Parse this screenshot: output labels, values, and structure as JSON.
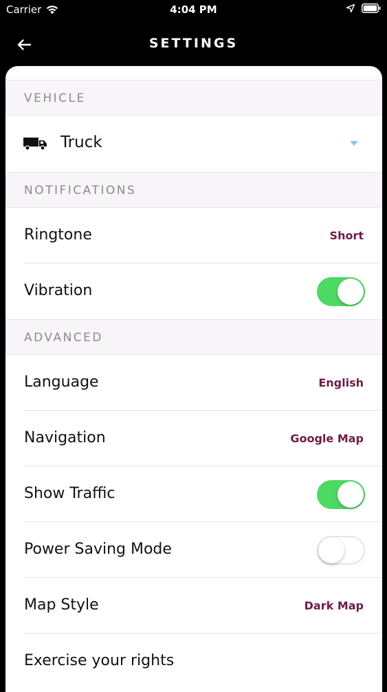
{
  "status_bar": {
    "carrier": "Carrier",
    "time": "4:04 PM"
  },
  "nav": {
    "title": "SETTINGS",
    "back_icon": "arrow-left-icon"
  },
  "sections": {
    "vehicle": {
      "header": "VEHICLE",
      "selected": "Truck",
      "icon": "truck-icon"
    },
    "notifications": {
      "header": "NOTIFICATIONS",
      "ringtone": {
        "label": "Ringtone",
        "value": "Short"
      },
      "vibration": {
        "label": "Vibration",
        "enabled": true
      }
    },
    "advanced": {
      "header": "ADVANCED",
      "language": {
        "label": "Language",
        "value": "English"
      },
      "navigation": {
        "label": "Navigation",
        "value": "Google Map"
      },
      "show_traffic": {
        "label": "Show Traffic",
        "enabled": true
      },
      "power_saving": {
        "label": "Power Saving Mode",
        "enabled": false
      },
      "map_style": {
        "label": "Map Style",
        "value": "Dark Map"
      },
      "rights": {
        "label": "Exercise your rights"
      }
    }
  },
  "colors": {
    "accent_value": "#6d1d45",
    "toggle_on": "#4cd964",
    "dropdown_arrow": "#8ec5e8"
  }
}
